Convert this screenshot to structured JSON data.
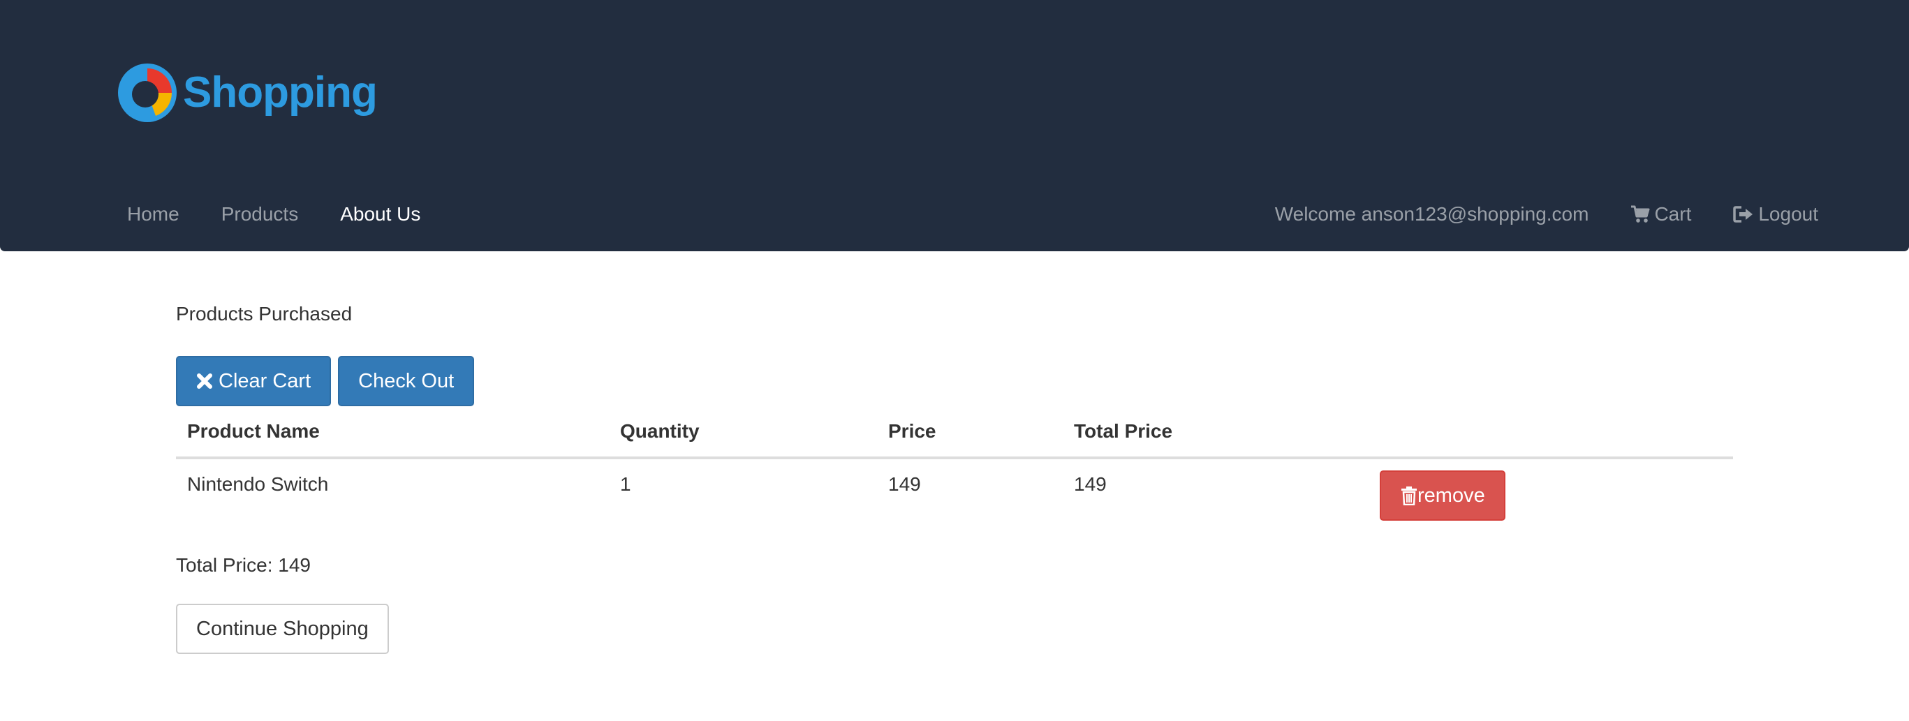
{
  "brand": {
    "name": "Shopping",
    "colors": {
      "header_bg": "#222d3f",
      "logo_blue": "#2d9be0",
      "logo_red": "#e8392c",
      "logo_yellow": "#f5b400",
      "primary": "#337ab7",
      "danger": "#d9534f"
    }
  },
  "nav": {
    "left": [
      {
        "label": "Home",
        "active": false
      },
      {
        "label": "Products",
        "active": false
      },
      {
        "label": "About Us",
        "active": true
      }
    ],
    "welcome": "Welcome anson123@shopping.com",
    "cart": {
      "label": "Cart",
      "icon": "shopping-cart-icon"
    },
    "logout": {
      "label": "Logout",
      "icon": "logout-icon"
    }
  },
  "main": {
    "title": "Products Purchased",
    "clear_cart": {
      "label": "Clear Cart",
      "icon": "remove-x-icon"
    },
    "check_out": {
      "label": "Check Out"
    },
    "table": {
      "headers": [
        "Product Name",
        "Quantity",
        "Price",
        "Total Price"
      ],
      "rows": [
        {
          "name": "Nintendo Switch",
          "quantity": "1",
          "price": "149",
          "total": "149",
          "action": "remove",
          "action_icon": "trash-icon"
        }
      ]
    },
    "total_label": "Total Price: 149",
    "continue": {
      "label": "Continue Shopping"
    }
  }
}
